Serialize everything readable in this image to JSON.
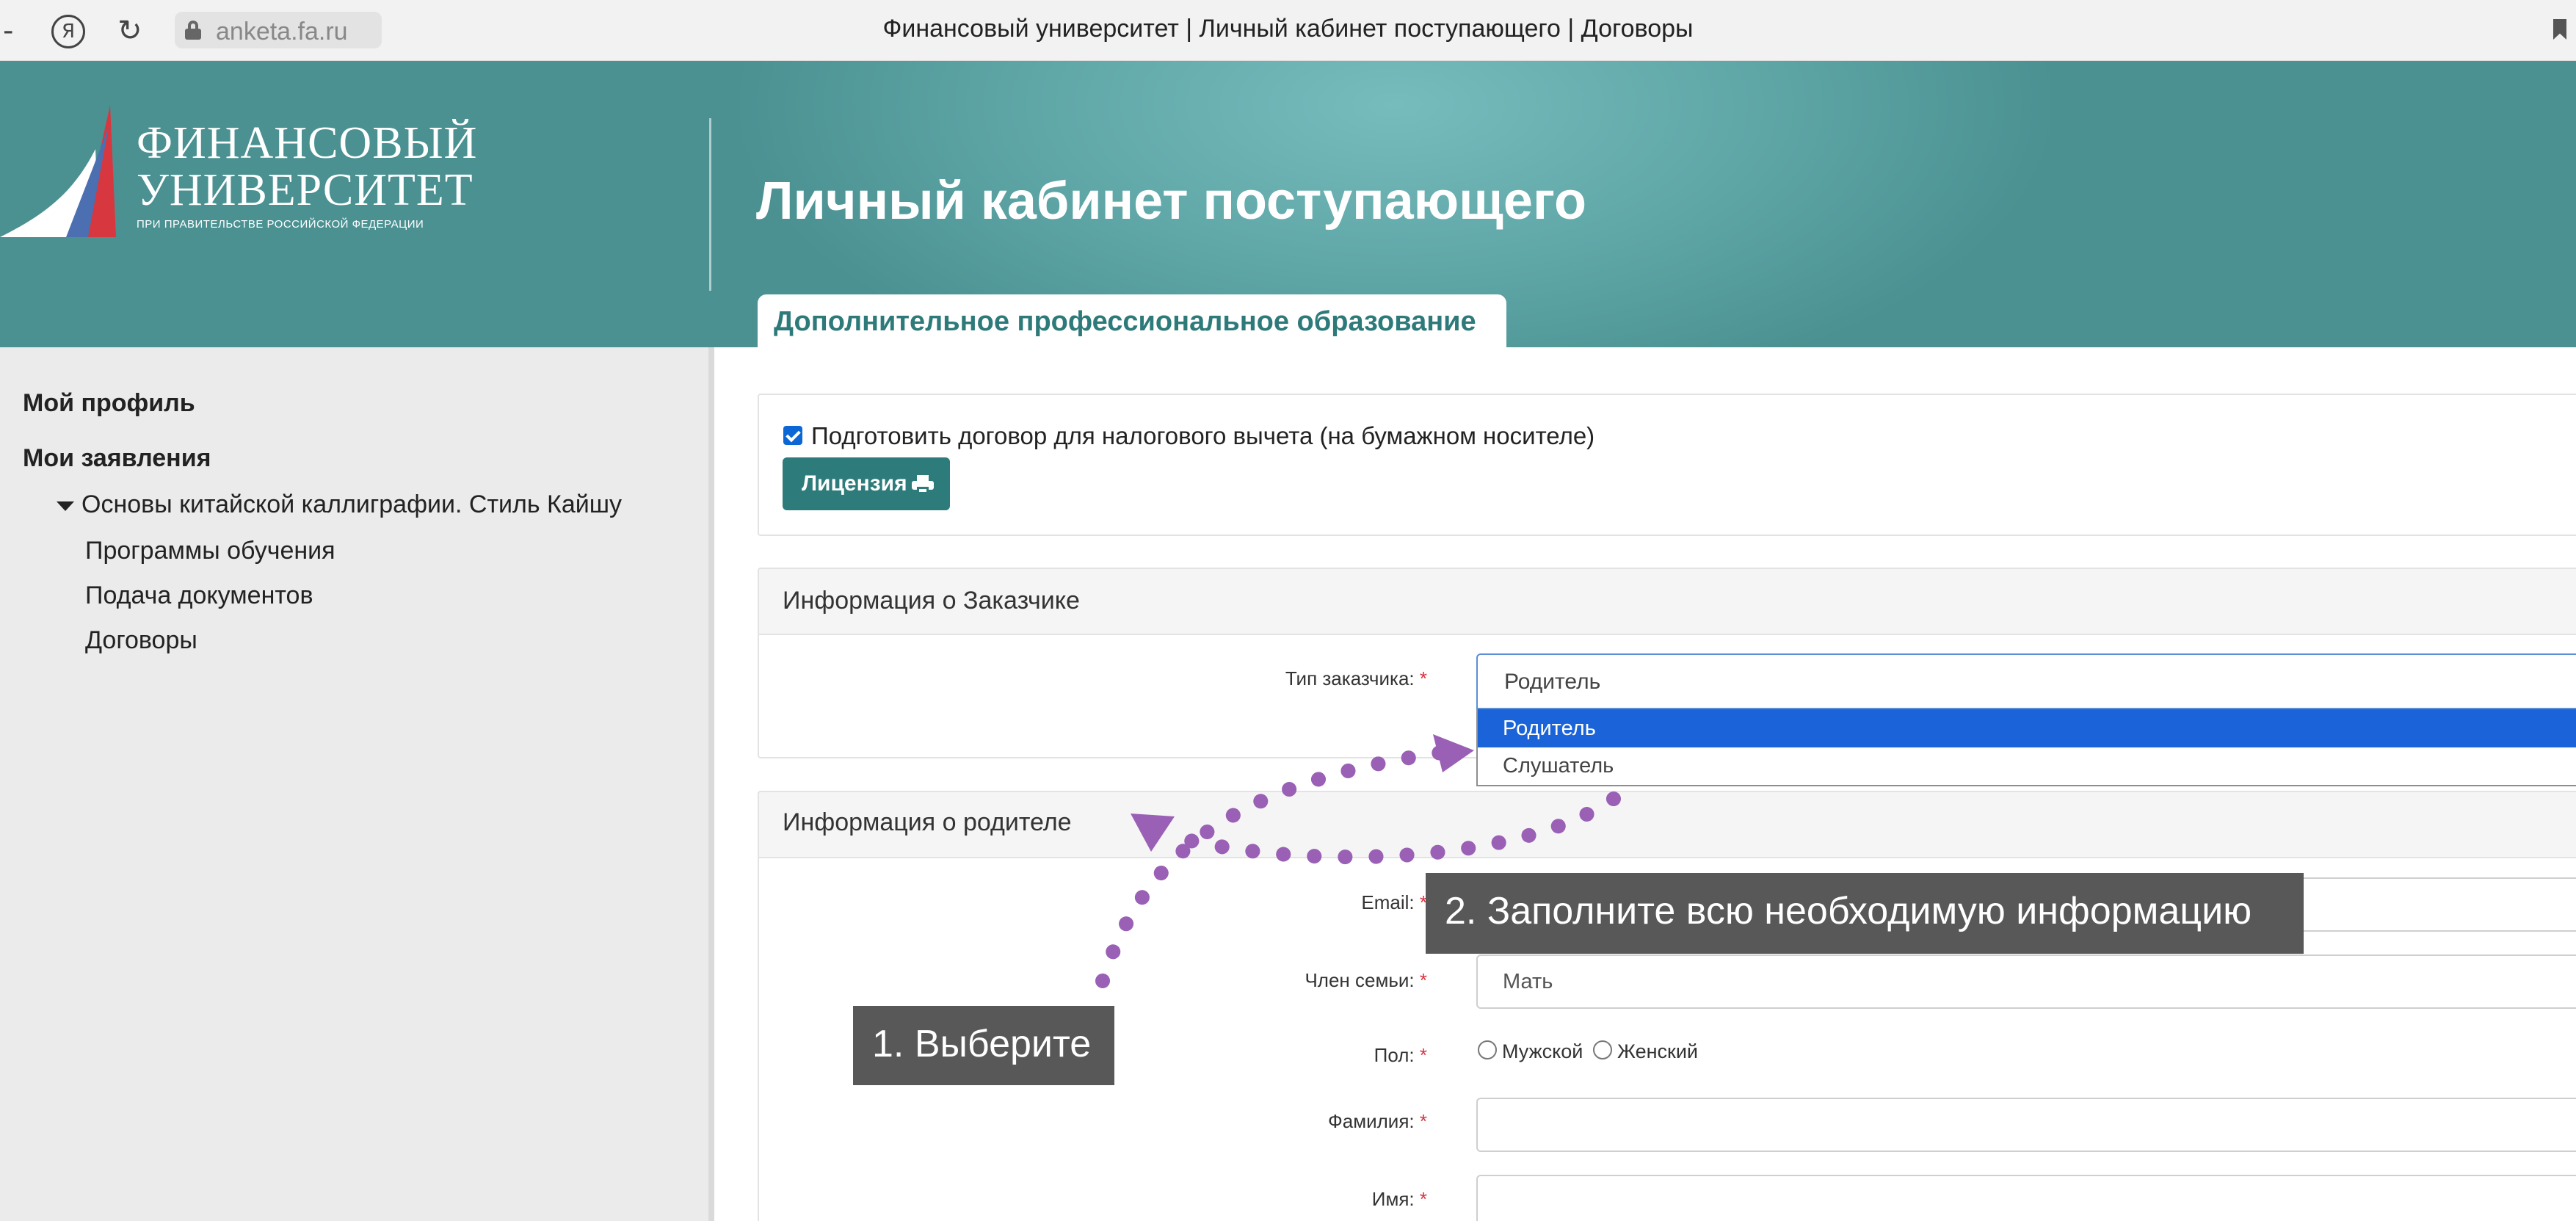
{
  "browser": {
    "back_glyph": "-",
    "yandex_glyph": "Я",
    "reload_glyph": "↻",
    "url": "anketa.fa.ru",
    "title": "Финансовый университет | Личный кабинет поступающего | Договоры"
  },
  "header": {
    "logo_line1": "ФИНАНСОВЫЙ",
    "logo_line2": "УНИВЕРСИТЕТ",
    "logo_line3": "ПРИ ПРАВИТЕЛЬСТВЕ РОССИЙСКОЙ ФЕДЕРАЦИИ",
    "title": "Личный кабинет поступающего",
    "tab": "Дополнительное профессиональное образование"
  },
  "sidebar": {
    "profile": "Мой профиль",
    "applications": "Мои заявления",
    "course": "Основы китайской каллиграфии. Стиль Кайшу",
    "items": [
      "Программы обучения",
      "Подача документов",
      "Договоры"
    ]
  },
  "contract": {
    "checkbox_label": "Подготовить договор для налогового вычета (на бумажном носителе)",
    "license_button": "Лицензия"
  },
  "customer": {
    "header": "Информация о Заказчике",
    "type_label": "Тип заказчика:",
    "type_value": "Родитель",
    "options": [
      "Родитель",
      "Слушатель"
    ],
    "selected_option": "Родитель"
  },
  "parent": {
    "header": "Информация о родителе",
    "email_label": "Email:",
    "family_label": "Член семьи:",
    "family_value": "Мать",
    "gender_label": "Пол:",
    "gender_options": [
      "Мужской",
      "Женский"
    ],
    "surname_label": "Фамилия:",
    "name_label": "Имя:",
    "required_mark": "*"
  },
  "annotations": {
    "step1": "1. Выберите",
    "step2": "2. Заполните всю необходимую информацию",
    "arrow_color": "#9a60b5"
  },
  "colors": {
    "header_teal": "#5fa6a7",
    "button_teal": "#2d7b7b",
    "select_blue": "#1a63d8",
    "required_red": "#d9333f"
  }
}
